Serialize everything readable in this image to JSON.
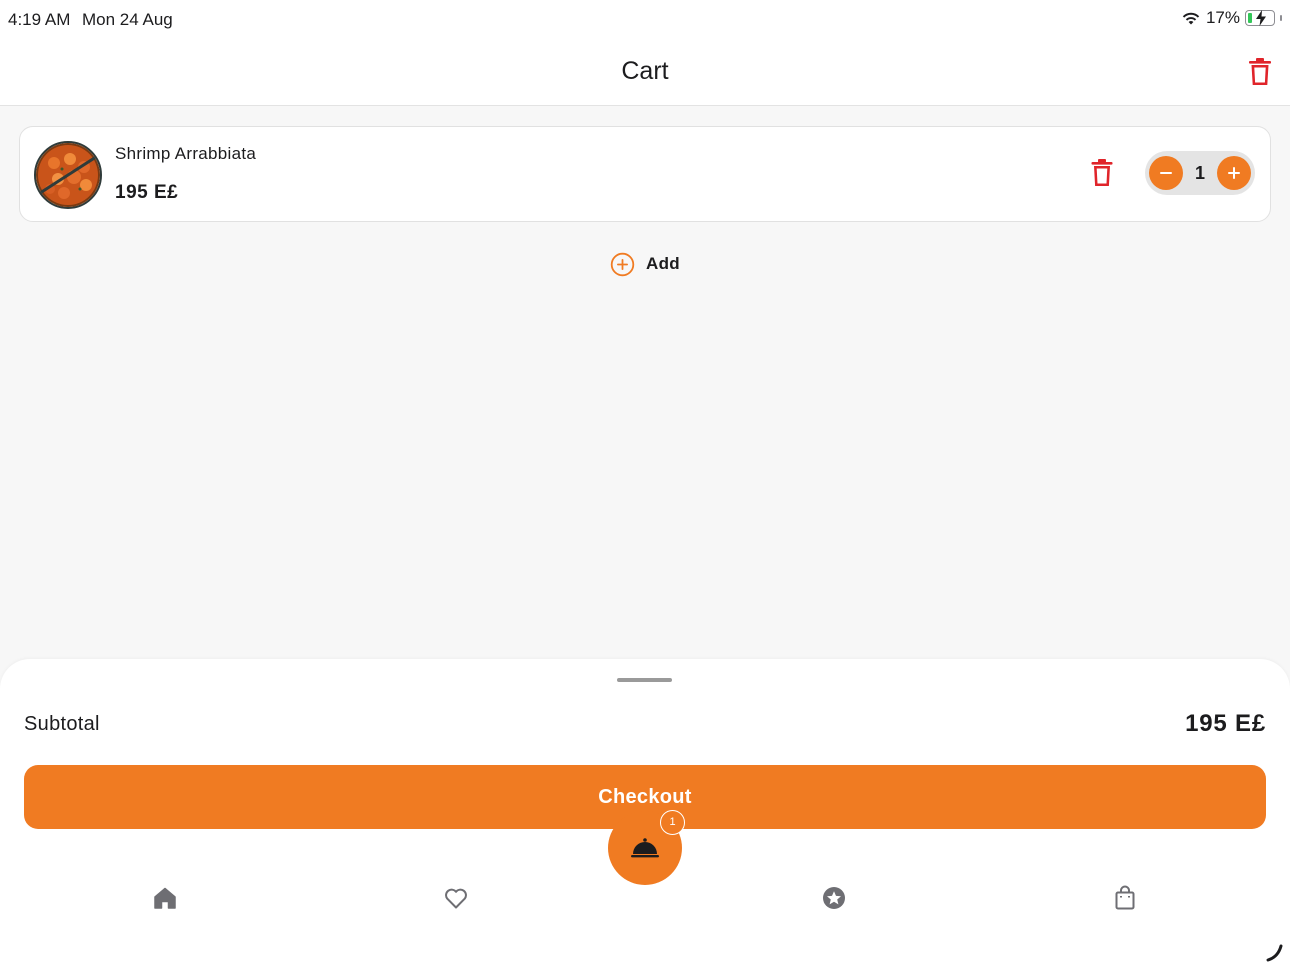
{
  "status_bar": {
    "time": "4:19 AM",
    "date": "Mon 24 Aug",
    "battery": "17%",
    "battery_level": 0.17
  },
  "header": {
    "title": "Cart",
    "clear_cart_icon": "trash-icon"
  },
  "cart": {
    "items": [
      {
        "name": "Shrimp Arrabbiata",
        "price": "195 E£",
        "quantity": "1"
      }
    ],
    "add_label": "Add"
  },
  "summary": {
    "subtotal_label": "Subtotal",
    "subtotal_value": "195 E£",
    "checkout_label": "Checkout"
  },
  "tab_bar": {
    "tabs": [
      "home-icon",
      "heart-icon",
      "cloche-icon",
      "star-badge-icon",
      "shopping-bag-icon"
    ],
    "cart_badge": "1"
  },
  "colors": {
    "accent": "#f07b22",
    "danger": "#e0242a",
    "tab_icon": "#6e6e73"
  }
}
